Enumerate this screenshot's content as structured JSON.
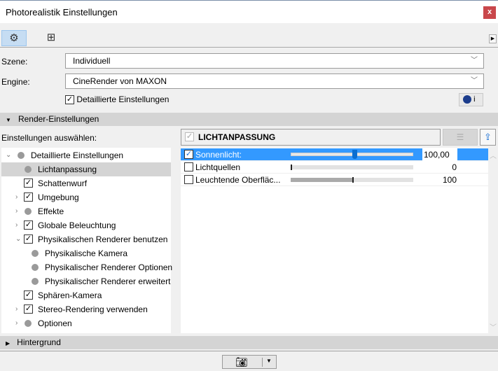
{
  "window": {
    "title": "Photorealistik Einstellungen",
    "close": "x"
  },
  "toolbar": {
    "tabs": [
      {
        "icon": "gear-icon",
        "selected": true
      },
      {
        "icon": "size-icon",
        "selected": false
      }
    ]
  },
  "scene": {
    "label": "Szene:",
    "value": "Individuell"
  },
  "engine": {
    "label": "Engine:",
    "value": "CineRender von MAXON"
  },
  "detailed": {
    "label": "Detaillierte Einstellungen",
    "checked": true
  },
  "info_button": {
    "label": "i"
  },
  "render_section": {
    "title": "Render-Einstellungen",
    "select_label": "Einstellungen auswählen:"
  },
  "tree": [
    {
      "label": "Detaillierte Einstellungen",
      "kind": "dot",
      "twisty": "open",
      "level": 0
    },
    {
      "label": "Lichtanpassung",
      "kind": "dot",
      "twisty": "",
      "level": 1,
      "selected": true
    },
    {
      "label": "Schattenwurf",
      "kind": "check",
      "twisty": "",
      "level": 1
    },
    {
      "label": "Umgebung",
      "kind": "check",
      "twisty": "closed",
      "level": 1
    },
    {
      "label": "Effekte",
      "kind": "dot",
      "twisty": "closed",
      "level": 1
    },
    {
      "label": "Globale Beleuchtung",
      "kind": "check",
      "twisty": "closed",
      "level": 1
    },
    {
      "label": "Physikalischen Renderer benutzen",
      "kind": "check",
      "twisty": "open",
      "level": 1
    },
    {
      "label": "Physikalische Kamera",
      "kind": "dot",
      "twisty": "",
      "level": 2
    },
    {
      "label": "Physikalischer Renderer Optionen",
      "kind": "dot",
      "twisty": "",
      "level": 2
    },
    {
      "label": "Physikalischer Renderer erweitert",
      "kind": "dot",
      "twisty": "",
      "level": 2
    },
    {
      "label": "Sphären-Kamera",
      "kind": "check",
      "twisty": "",
      "level": 1
    },
    {
      "label": "Stereo-Rendering verwenden",
      "kind": "check",
      "twisty": "closed",
      "level": 1
    },
    {
      "label": "Optionen",
      "kind": "dot",
      "twisty": "closed",
      "level": 1
    }
  ],
  "panel": {
    "title": "LICHTANPASSUNG",
    "rows": [
      {
        "label": "Sonnenlicht:",
        "checked": true,
        "value": "100,00",
        "percent": 50,
        "selected": true
      },
      {
        "label": "Lichtquellen",
        "checked": false,
        "value": "0",
        "percent": 0
      },
      {
        "label": "Leuchtende Oberfläc...",
        "checked": false,
        "value": "100",
        "percent": 50
      }
    ]
  },
  "background_section": {
    "title": "Hintergrund"
  }
}
